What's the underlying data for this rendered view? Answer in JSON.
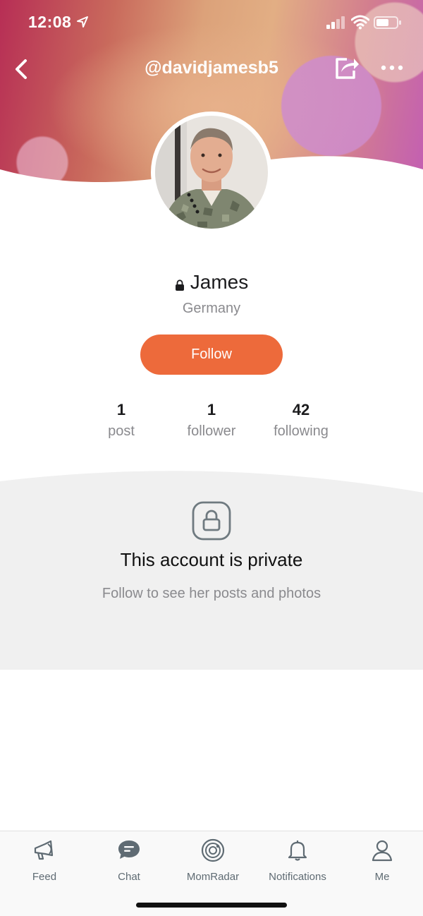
{
  "status_bar": {
    "time": "12:08"
  },
  "nav": {
    "title": "@davidjamesb5"
  },
  "profile": {
    "name": "James",
    "location": "Germany",
    "follow_label": "Follow",
    "stats": [
      {
        "value": "1",
        "label": "post"
      },
      {
        "value": "1",
        "label": "follower"
      },
      {
        "value": "42",
        "label": "following"
      }
    ]
  },
  "private_notice": {
    "title": "This account is private",
    "subtitle": "Follow to see her posts and photos"
  },
  "tabbar": {
    "items": [
      {
        "label": "Feed",
        "icon": "megaphone-icon"
      },
      {
        "label": "Chat",
        "icon": "chat-bubble-icon"
      },
      {
        "label": "MomRadar",
        "icon": "radar-icon"
      },
      {
        "label": "Notifications",
        "icon": "bell-icon"
      },
      {
        "label": "Me",
        "icon": "person-icon"
      }
    ]
  },
  "colors": {
    "accent": "#ed6a3b",
    "chat_active": "#5f6b73",
    "private_bg": "#f0f0f0"
  }
}
